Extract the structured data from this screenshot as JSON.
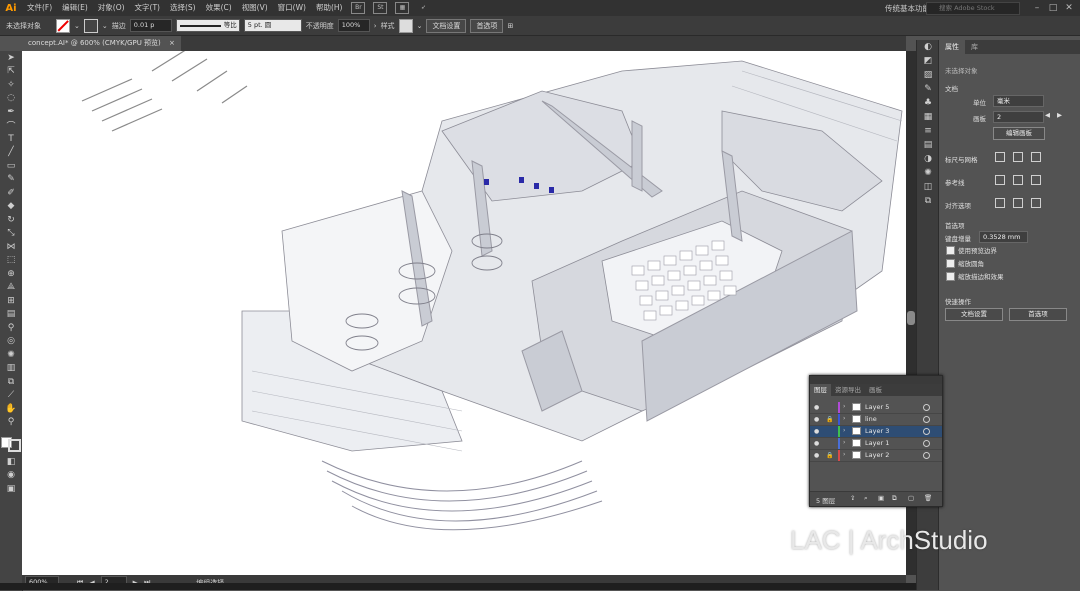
{
  "app": {
    "logo": "Ai",
    "workspace": "传统基本功能",
    "search_placeholder": "搜索 Adobe Stock",
    "bridge_icons": [
      "Br",
      "St"
    ]
  },
  "menu": [
    "文件(F)",
    "编辑(E)",
    "对象(O)",
    "文字(T)",
    "选择(S)",
    "效果(C)",
    "视图(V)",
    "窗口(W)",
    "帮助(H)"
  ],
  "controlbar": {
    "selection": "未选择对象",
    "stroke_label": "描边",
    "stroke_weight": "0.01 p",
    "stroke_style": "等比",
    "brush": "5 pt. 圆",
    "opacity_label": "不透明度",
    "opacity": "100%",
    "style_label": "样式",
    "doc_setup": "文档设置",
    "prefs": "首选项"
  },
  "document": {
    "tab": "concept.AI* @ 600% (CMYK/GPU 预览)",
    "close": "×"
  },
  "status": {
    "zoom": "600%",
    "artboard": "2",
    "tool": "编组选择"
  },
  "properties": {
    "tabs": [
      "属性",
      "库"
    ],
    "no_selection": "未选择对象",
    "document_label": "文档",
    "units_label": "单位",
    "units": "毫米",
    "artboard_label": "画板",
    "artboard": "2",
    "edit_artboards": "编辑画板",
    "rulers_grids": "标尺与网格",
    "guides": "参考线",
    "snap": "对齐选项",
    "prefs_label": "首选项",
    "key_increment_label": "键盘增量",
    "key_increment": "0.3528 mm",
    "use_preview_bounds": "使用预览边界",
    "scale_corners": "缩放圆角",
    "scale_strokes": "缩放描边和效果",
    "quick_actions": "快速操作",
    "doc_setup_btn": "文档设置",
    "prefs_btn": "首选项"
  },
  "layers": {
    "tabs": [
      "图层",
      "资源导出",
      "画板"
    ],
    "rows": [
      {
        "name": "Layer 5",
        "color": "#b04bd6",
        "locked": false,
        "selected": false
      },
      {
        "name": "line",
        "color": "#3a56d8",
        "locked": true,
        "selected": false
      },
      {
        "name": "Layer 3",
        "color": "#3fbf4f",
        "locked": false,
        "selected": true
      },
      {
        "name": "Layer 1",
        "color": "#4a6fd8",
        "locked": false,
        "selected": false
      },
      {
        "name": "Layer 2",
        "color": "#d84a4a",
        "locked": true,
        "selected": false
      }
    ],
    "count": "5 图层"
  },
  "watermark": "LAC | ArchStudio"
}
